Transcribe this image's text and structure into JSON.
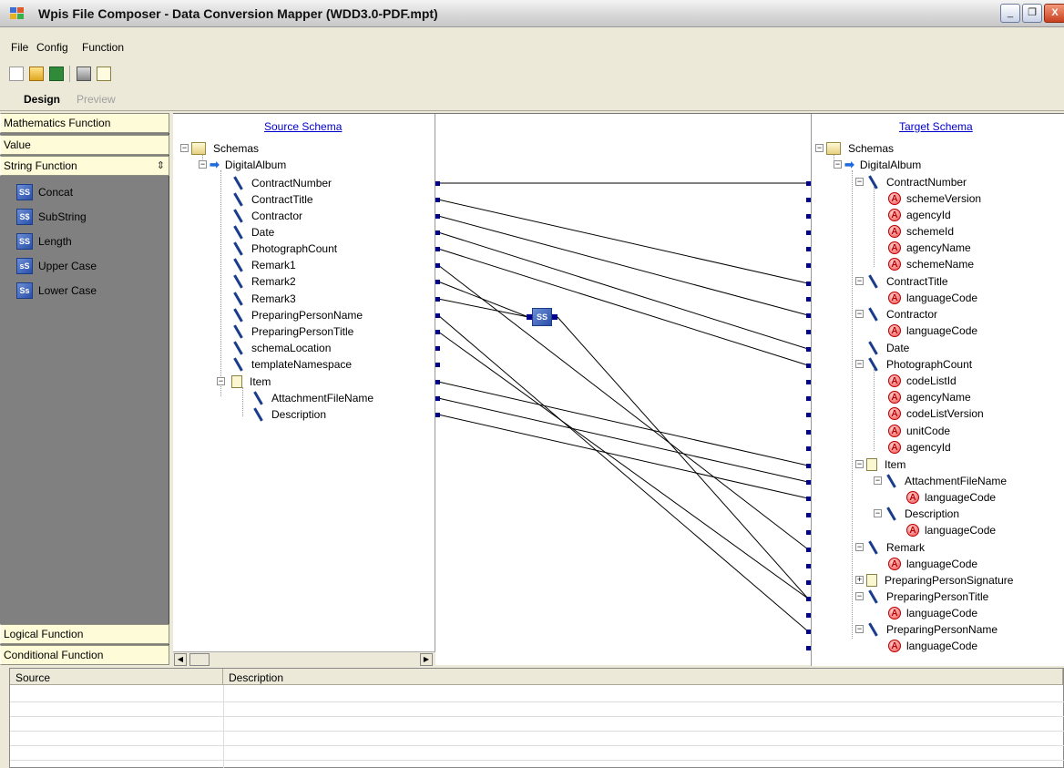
{
  "window": {
    "title": "Wpis File Composer - Data Conversion Mapper (WDD3.0-PDF.mpt)",
    "minimize": "_",
    "restore": "❐",
    "close": "X"
  },
  "menu": [
    "File",
    "Config",
    "Function"
  ],
  "toolbar_icons": [
    "new-file-icon",
    "open-folder-icon",
    "save-icon",
    "print-icon",
    "print-preview-icon"
  ],
  "tabs": {
    "design": "Design",
    "preview": "Preview"
  },
  "left_panel": {
    "sections": [
      "Mathematics Function",
      "Value",
      "String Function",
      "Logical Function",
      "Conditional Function"
    ],
    "string_functions": [
      {
        "label": "Concat",
        "icon": "SS"
      },
      {
        "label": "SubString",
        "icon": "S$"
      },
      {
        "label": "Length",
        "icon": "SS"
      },
      {
        "label": "Upper Case",
        "icon": "sS"
      },
      {
        "label": "Lower Case",
        "icon": "Ss"
      }
    ]
  },
  "source": {
    "title": "Source Schema",
    "nodes": [
      "Schemas",
      "DigitalAlbum",
      "ContractNumber",
      "ContractTitle",
      "Contractor",
      "Date",
      "PhotographCount",
      "Remark1",
      "Remark2",
      "Remark3",
      "PreparingPersonName",
      "PreparingPersonTitle",
      "schemaLocation",
      "templateNamespace",
      "Item",
      "AttachmentFileName",
      "Description"
    ]
  },
  "target": {
    "title": "Target Schema",
    "nodes": [
      "Schemas",
      "DigitalAlbum",
      "ContractNumber",
      "schemeVersion",
      "agencyId",
      "schemeId",
      "agencyName",
      "schemeName",
      "ContractTitle",
      "languageCode",
      "Contractor",
      "languageCode",
      "Date",
      "PhotographCount",
      "codeListId",
      "agencyName",
      "codeListVersion",
      "unitCode",
      "agencyId",
      "Item",
      "AttachmentFileName",
      "languageCode",
      "Description",
      "languageCode",
      "Remark",
      "languageCode",
      "PreparingPersonSignature",
      "PreparingPersonTitle",
      "languageCode",
      "PreparingPersonName",
      "languageCode"
    ]
  },
  "concat_node_label": "SS",
  "bottom_panel": {
    "columns": [
      "Source",
      "Description"
    ]
  },
  "colors": {
    "link_dots": "#00008b",
    "accordion_bg": "#fefbd8",
    "left_bg": "#808080",
    "title_link": "#0000cc"
  }
}
